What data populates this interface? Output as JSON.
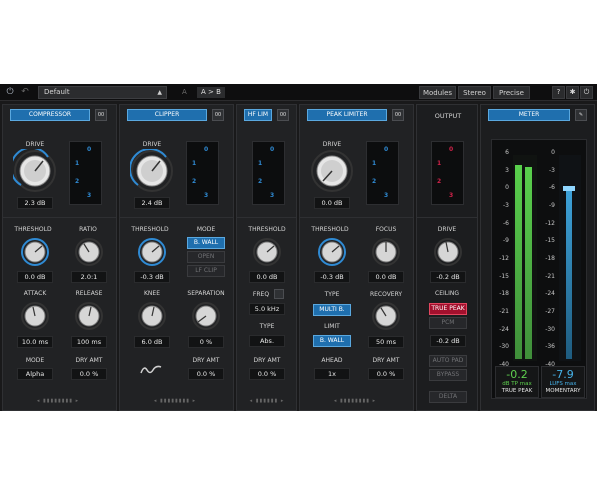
{
  "topbar": {
    "preset": "Default",
    "a_label": "A",
    "ab_label": "A > B",
    "modules": "Modules",
    "stereo": "Stereo",
    "precise": "Precise",
    "help": "?",
    "settings_icon": "gear-icon",
    "power_icon": "power-icon"
  },
  "compressor": {
    "title": "COMPRESSOR",
    "link": "00",
    "drive_label": "DRIVE",
    "drive_value": "2.3 dB",
    "threshold_label": "THRESHOLD",
    "threshold_value": "0.0 dB",
    "ratio_label": "RATIO",
    "ratio_value": "2.0:1",
    "attack_label": "ATTACK",
    "attack_value": "10.0 ms",
    "release_label": "RELEASE",
    "release_value": "100 ms",
    "mode_label": "MODE",
    "mode_value": "Alpha",
    "dry_label": "DRY AMT",
    "dry_value": "0.0 %",
    "band_labels": [
      "0",
      "1",
      "2",
      "3"
    ]
  },
  "clipper": {
    "title": "CLIPPER",
    "link": "00",
    "drive_label": "DRIVE",
    "drive_value": "2.4 dB",
    "threshold_label": "THRESHOLD",
    "threshold_value": "-0.3 dB",
    "mode_label": "MODE",
    "mode_buttons": [
      "B. WALL",
      "OPEN",
      "LF CLIP"
    ],
    "knee_label": "KNEE",
    "knee_value": "6.0 dB",
    "separation_label": "SEPARATION",
    "separation_value": "0 %",
    "dry_label": "DRY AMT",
    "dry_value": "0.0 %",
    "band_labels": [
      "0",
      "1",
      "2",
      "3"
    ]
  },
  "hflim": {
    "title": "HF LIM",
    "link": "00",
    "threshold_label": "THRESHOLD",
    "threshold_value": "0.0 dB",
    "freq_label": "FREQ",
    "freq_value": "5.0 kHz",
    "type_label": "TYPE",
    "type_value": "Abs.",
    "dry_label": "DRY AMT",
    "dry_value": "0.0 %",
    "band_labels": [
      "0",
      "1",
      "2",
      "3"
    ]
  },
  "peaklimiter": {
    "title": "PEAK LIMITER",
    "link": "00",
    "drive_label": "DRIVE",
    "drive_value": "0.0 dB",
    "threshold_label": "THRESHOLD",
    "threshold_value": "-0.3 dB",
    "focus_label": "FOCUS",
    "focus_value": "0.0 dB",
    "type_label": "TYPE",
    "type_button": "MULTI B.",
    "recovery_label": "RECOVERY",
    "recovery_value": "50 ms",
    "limit_label": "LIMIT",
    "limit_button": "B. WALL",
    "ahead_label": "AHEAD",
    "ahead_value": "1x",
    "dry_label": "DRY AMT",
    "dry_value": "0.0 %",
    "band_labels": [
      "0",
      "1",
      "2",
      "3"
    ]
  },
  "output": {
    "title": "OUTPUT",
    "drive_label": "DRIVE",
    "drive_value": "-0.2 dB",
    "ceiling_label": "CEILING",
    "truepeak": "TRUE PEAK",
    "pcm": "PCM",
    "autopad": "AUTO PAD",
    "bypass": "BYPASS",
    "delta": "DELTA",
    "band_labels": [
      "0",
      "1",
      "2",
      "3"
    ]
  },
  "meter": {
    "title": "METER",
    "scale_left": [
      "6",
      "3",
      "0",
      "-3",
      "-6",
      "-9",
      "-12",
      "-15",
      "-18",
      "-21",
      "-24",
      "-30",
      "-40"
    ],
    "scale_right": [
      "0",
      "-3",
      "-6",
      "-9",
      "-12",
      "-15",
      "-18",
      "-21",
      "-24",
      "-27",
      "-30",
      "-36",
      "-40"
    ],
    "tp_value": "-0.2",
    "tp_unit": "dB TP max",
    "tp_label": "TRUE PEAK",
    "lufs_value": "-7.9",
    "lufs_unit": "LUFS max",
    "lufs_label": "MOMENTARY",
    "true_peak_level": 0.94,
    "momentary_level": 0.84
  },
  "colors": {
    "accent_blue": "#1f6fae",
    "accent_red": "#d12249",
    "meter_green": "#4fbf45",
    "meter_blue": "#3ea4dc"
  }
}
